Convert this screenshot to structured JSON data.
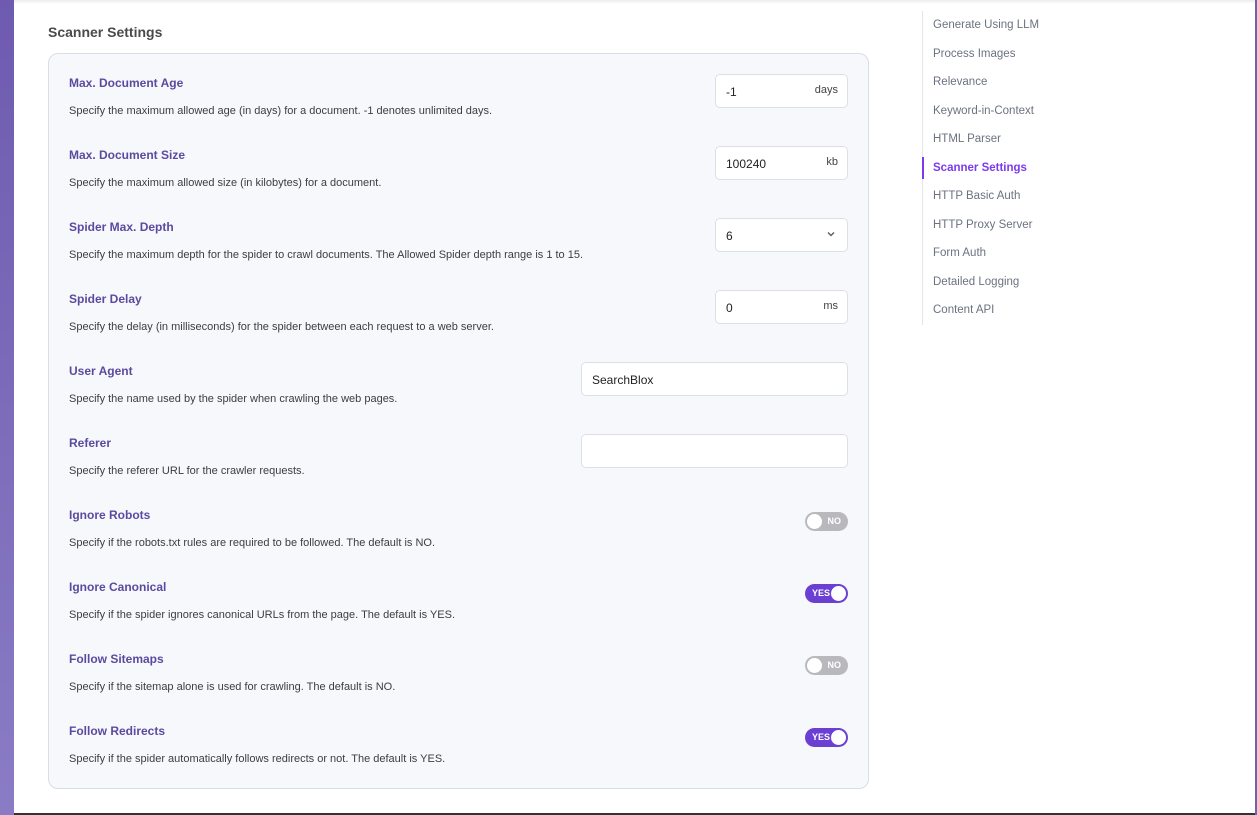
{
  "section_title": "Scanner Settings",
  "settings": [
    {
      "label": "Max. Document Age",
      "desc": "Specify the maximum allowed age (in days) for a document. -1 denotes unlimited days.",
      "value": "-1",
      "unit": "days"
    },
    {
      "label": "Max. Document Size",
      "desc": "Specify the maximum allowed size (in kilobytes) for a document.",
      "value": "100240",
      "unit": "kb"
    },
    {
      "label": "Spider Max. Depth",
      "desc": "Specify the maximum depth for the spider to crawl documents. The Allowed Spider depth range is 1 to 15.",
      "value": "6"
    },
    {
      "label": "Spider Delay",
      "desc": "Specify the delay (in milliseconds) for the spider between each request to a web server.",
      "value": "0",
      "unit": "ms"
    },
    {
      "label": "User Agent",
      "desc": "Specify the name used by the spider when crawling the web pages.",
      "value": "SearchBlox"
    },
    {
      "label": "Referer",
      "desc": "Specify the referer URL for the crawler requests.",
      "value": ""
    },
    {
      "label": "Ignore Robots",
      "desc": "Specify if the robots.txt rules are required to be followed. The default is NO.",
      "toggle": "NO"
    },
    {
      "label": "Ignore Canonical",
      "desc": "Specify if the spider ignores canonical URLs from the page. The default is YES.",
      "toggle": "YES"
    },
    {
      "label": "Follow Sitemaps",
      "desc": "Specify if the sitemap alone is used for crawling. The default is NO.",
      "toggle": "NO"
    },
    {
      "label": "Follow Redirects",
      "desc": "Specify if the spider automatically follows redirects or not. The default is YES.",
      "toggle": "YES"
    }
  ],
  "sidenav": {
    "items": [
      "Generate Using LLM",
      "Process Images",
      "Relevance",
      "Keyword-in-Context",
      "HTML Parser",
      "Scanner Settings",
      "HTTP Basic Auth",
      "HTTP Proxy Server",
      "Form Auth",
      "Detailed Logging",
      "Content API"
    ],
    "active": "Scanner Settings"
  },
  "icons": {
    "select": "chevron-down-icon"
  },
  "colors": {
    "accent": "#7c3aed",
    "label": "#5b4a9e",
    "toggle_on": "#6a3fd1",
    "toggle_off": "#b9b9bd"
  }
}
